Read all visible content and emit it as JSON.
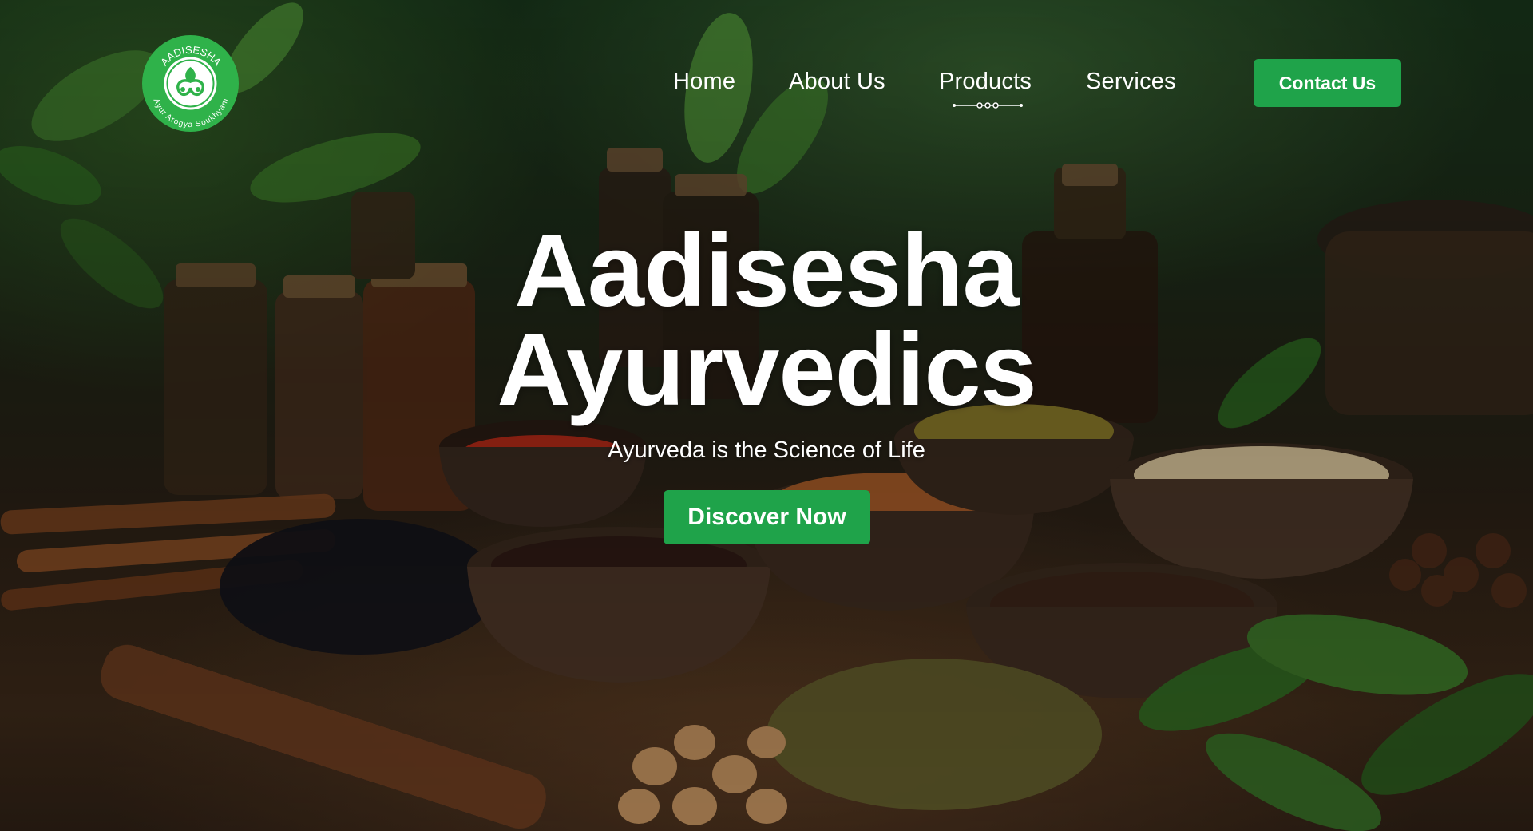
{
  "logo": {
    "top_text": "AADISESHA",
    "bottom_text": "Ayur Arogya Soukhyam",
    "icon": "leaf-emblem-icon",
    "color": "#2fb24a"
  },
  "nav": {
    "items": [
      {
        "label": "Home"
      },
      {
        "label": "About Us"
      },
      {
        "label": "Products"
      },
      {
        "label": "Services"
      }
    ],
    "active": "Products",
    "contact_label": "Contact Us"
  },
  "hero": {
    "title_line1": "Aadisesha",
    "title_line2": "Ayurvedics",
    "subtitle": "Ayurveda is the Science of Life",
    "cta_label": "Discover Now",
    "background_image": "ayurvedic-spices-and-herbs-photo"
  },
  "colors": {
    "accent": "#1fa34a",
    "text": "#ffffff"
  }
}
